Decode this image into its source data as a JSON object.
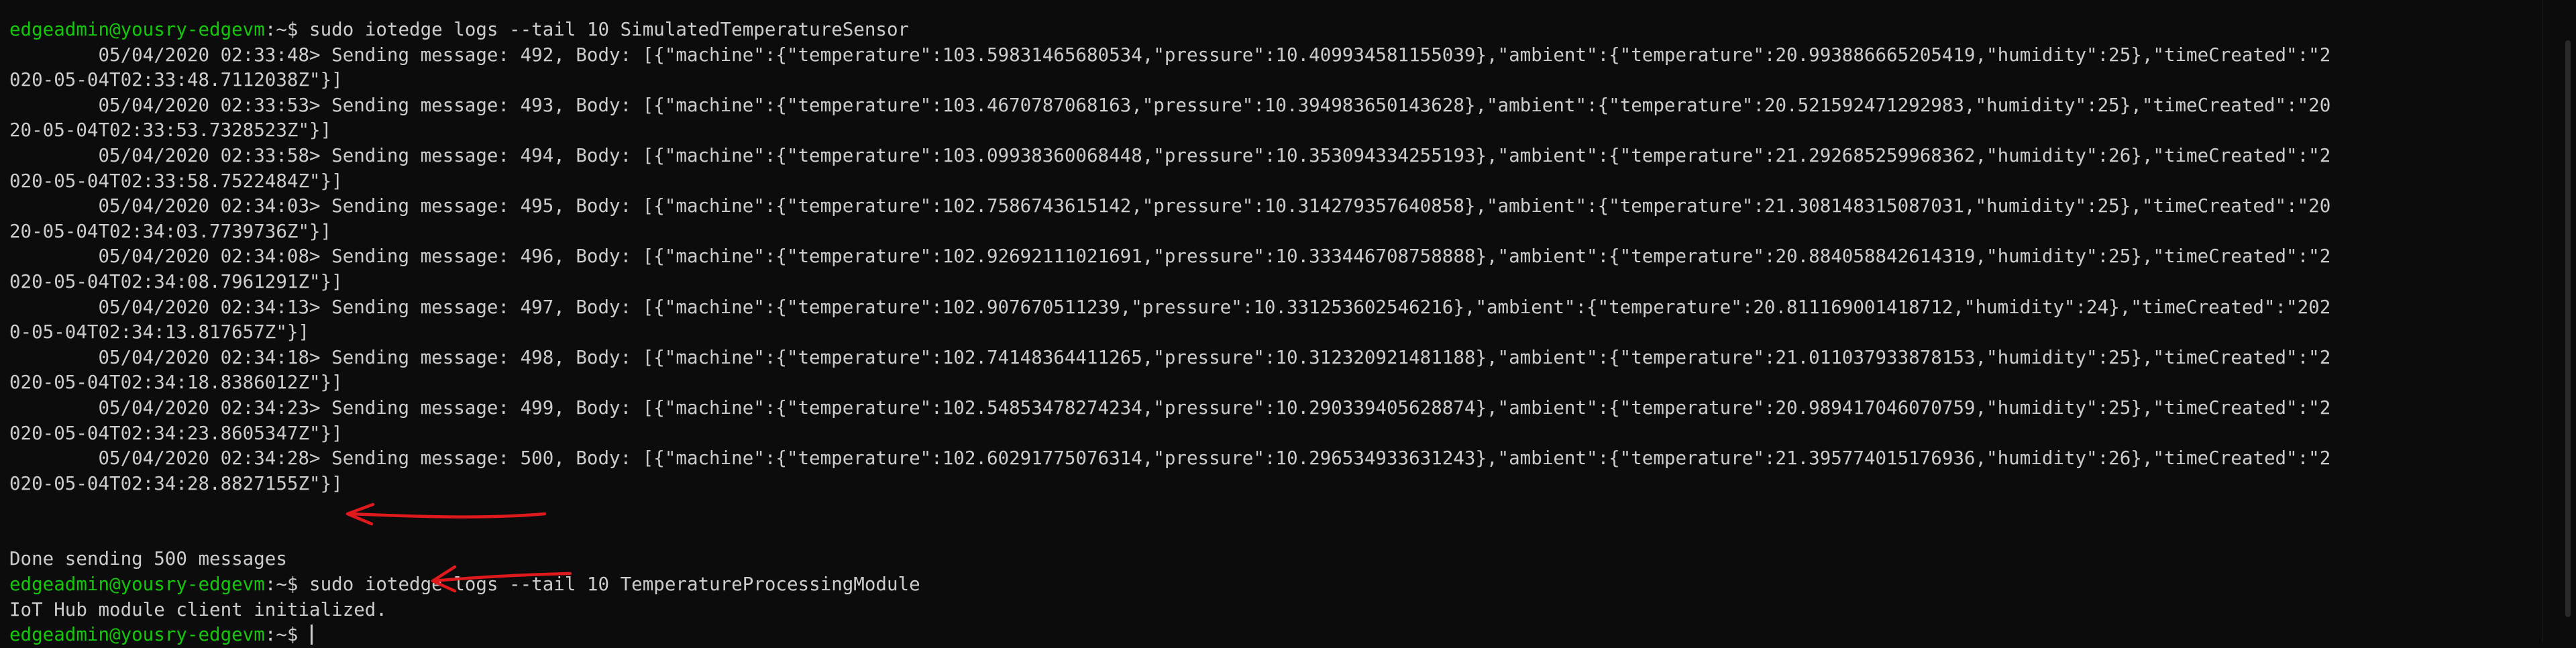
{
  "terminal": {
    "prompt_user": "edgeadmin@yousry-edgevm",
    "prompt_suffix": ":~$",
    "cmd1": " sudo iotedge logs --tail 10 SimulatedTemperatureSensor",
    "lines": [
      "        05/04/2020 02:33:48> Sending message: 492, Body: [{\"machine\":{\"temperature\":103.59831465680534,\"pressure\":10.409934581155039},\"ambient\":{\"temperature\":20.993886665205419,\"humidity\":25},\"timeCreated\":\"2",
      "020-05-04T02:33:48.7112038Z\"}]",
      "        05/04/2020 02:33:53> Sending message: 493, Body: [{\"machine\":{\"temperature\":103.4670787068163,\"pressure\":10.394983650143628},\"ambient\":{\"temperature\":20.521592471292983,\"humidity\":25},\"timeCreated\":\"20",
      "20-05-04T02:33:53.7328523Z\"}]",
      "        05/04/2020 02:33:58> Sending message: 494, Body: [{\"machine\":{\"temperature\":103.09938360068448,\"pressure\":10.353094334255193},\"ambient\":{\"temperature\":21.292685259968362,\"humidity\":26},\"timeCreated\":\"2",
      "020-05-04T02:33:58.7522484Z\"}]",
      "        05/04/2020 02:34:03> Sending message: 495, Body: [{\"machine\":{\"temperature\":102.7586743615142,\"pressure\":10.314279357640858},\"ambient\":{\"temperature\":21.308148315087031,\"humidity\":25},\"timeCreated\":\"20",
      "20-05-04T02:34:03.7739736Z\"}]",
      "        05/04/2020 02:34:08> Sending message: 496, Body: [{\"machine\":{\"temperature\":102.92692111021691,\"pressure\":10.333446708758888},\"ambient\":{\"temperature\":20.884058842614319,\"humidity\":25},\"timeCreated\":\"2",
      "020-05-04T02:34:08.7961291Z\"}]",
      "        05/04/2020 02:34:13> Sending message: 497, Body: [{\"machine\":{\"temperature\":102.907670511239,\"pressure\":10.331253602546216},\"ambient\":{\"temperature\":20.811169001418712,\"humidity\":24},\"timeCreated\":\"202",
      "0-05-04T02:34:13.817657Z\"}]",
      "        05/04/2020 02:34:18> Sending message: 498, Body: [{\"machine\":{\"temperature\":102.74148364411265,\"pressure\":10.312320921481188},\"ambient\":{\"temperature\":21.011037933878153,\"humidity\":25},\"timeCreated\":\"2",
      "020-05-04T02:34:18.8386012Z\"}]",
      "        05/04/2020 02:34:23> Sending message: 499, Body: [{\"machine\":{\"temperature\":102.54853478274234,\"pressure\":10.290339405628874},\"ambient\":{\"temperature\":20.989417046070759,\"humidity\":25},\"timeCreated\":\"2",
      "020-05-04T02:34:23.8605347Z\"}]",
      "        05/04/2020 02:34:28> Sending message: 500, Body: [{\"machine\":{\"temperature\":102.60291775076314,\"pressure\":10.296534933631243},\"ambient\":{\"temperature\":21.395774015176936,\"humidity\":26},\"timeCreated\":\"2",
      "020-05-04T02:34:28.8827155Z\"}]"
    ],
    "done": "Done sending 500 messages",
    "cmd2": " sudo iotedge logs --tail 10 TemperatureProcessingModule",
    "iot_init": "IoT Hub module client initialized.",
    "prompt_trailing": " "
  },
  "colors": {
    "background": "#0c0c0c",
    "text": "#cccccc",
    "prompt": "#16c60c",
    "annotation_arrow": "#e0191c"
  },
  "icons": {
    "arrow_1": "red-arrow-icon",
    "arrow_2": "red-arrow-icon"
  }
}
